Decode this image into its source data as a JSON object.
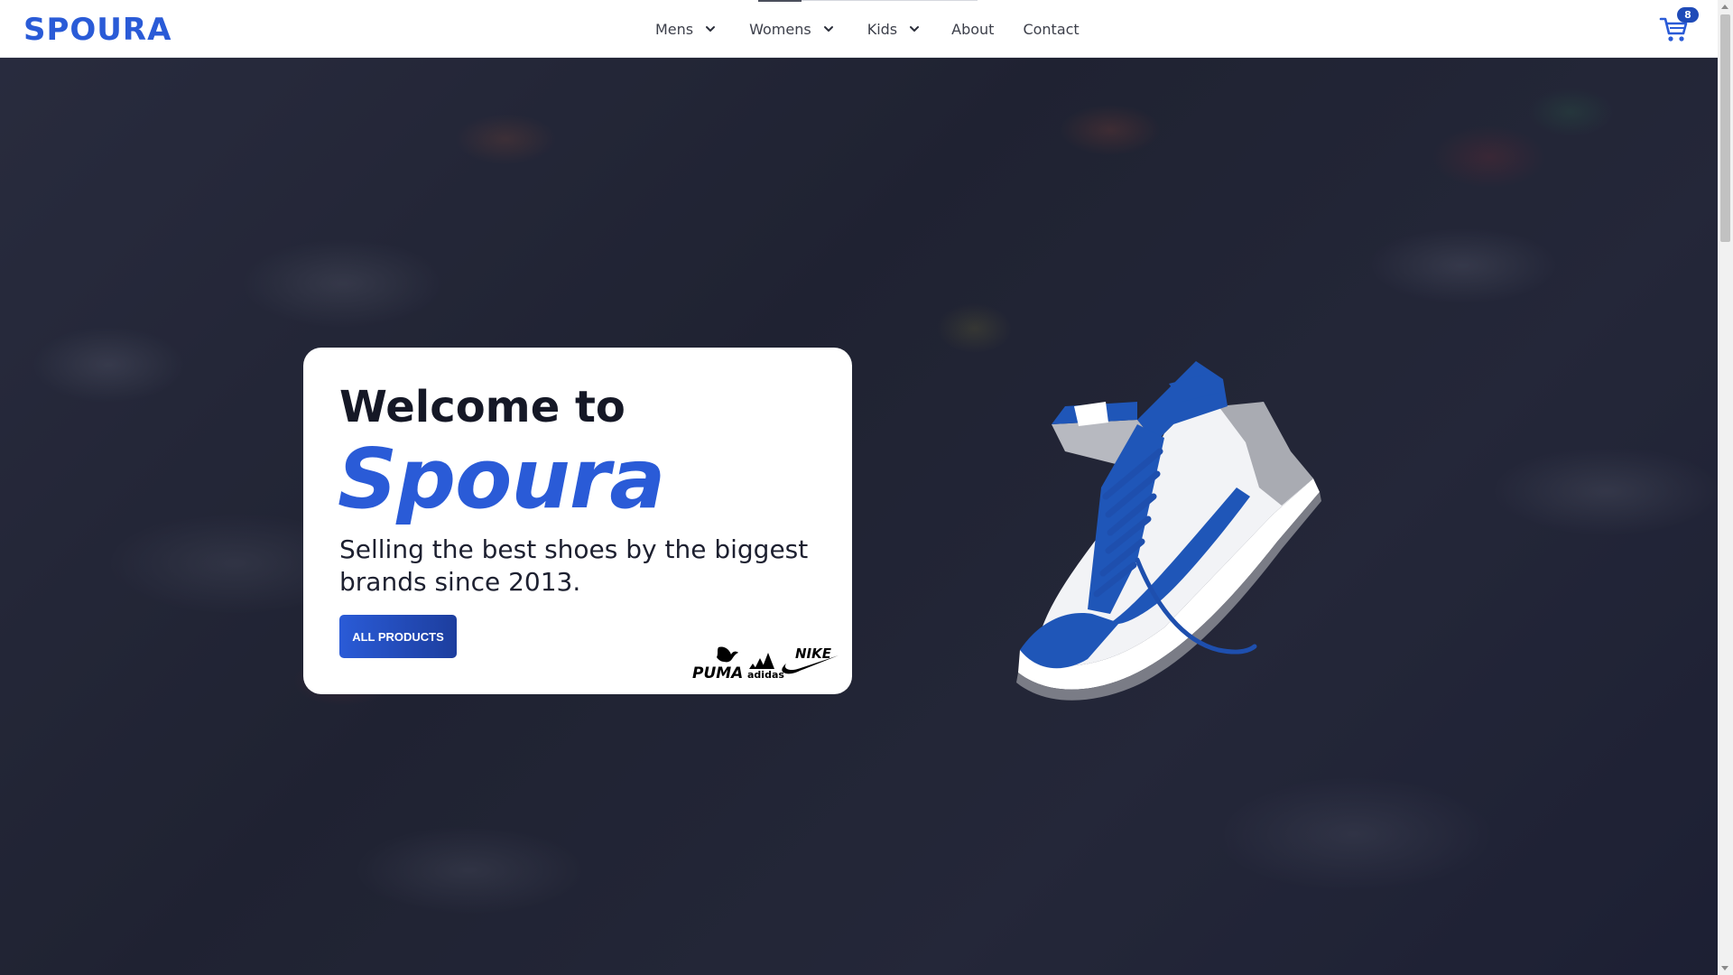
{
  "header": {
    "logo": "SPOURA",
    "nav": {
      "mens": "Mens",
      "womens": "Womens",
      "kids": "Kids",
      "about": "About",
      "contact": "Contact"
    },
    "cart_count": "8"
  },
  "hero": {
    "welcome": "Welcome to",
    "brand": "Spoura",
    "tagline": "Selling the best shoes by the biggest brands since 2013.",
    "button_label": "ALL PRODUCTS",
    "brand_logos": [
      "PUMA",
      "adidas",
      "NIKE"
    ]
  },
  "colors": {
    "accent": "#2a5bd7",
    "accent_dark": "#1d3e9e",
    "text_dark": "#151826"
  },
  "icons": {
    "cart": "shopping-cart-icon",
    "chevron": "chevron-down-icon"
  }
}
